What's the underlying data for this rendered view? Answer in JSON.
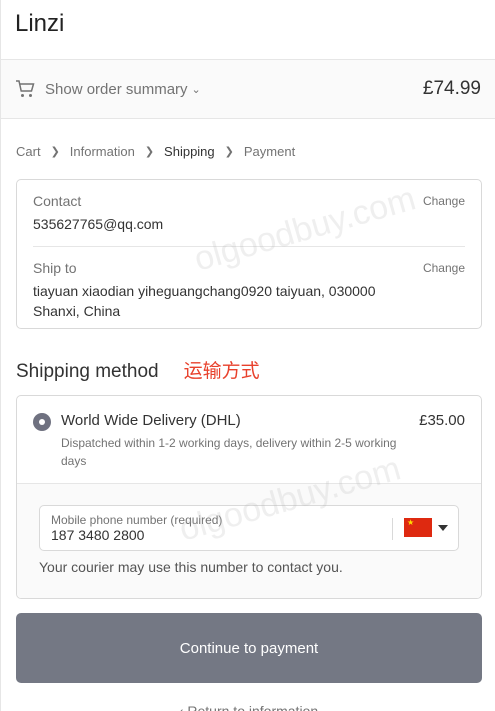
{
  "header": {
    "store_name": "Linzi"
  },
  "summary": {
    "toggle_label": "Show order summary",
    "total": "£74.99"
  },
  "breadcrumb": {
    "items": [
      "Cart",
      "Information",
      "Shipping",
      "Payment"
    ]
  },
  "review": {
    "contact_label": "Contact",
    "contact_value": "535627765@qq.com",
    "ship_label": "Ship to",
    "ship_value": "tiayuan xiaodian yiheguangchang0920 taiyuan, 030000 Shanxi, China",
    "change_label": "Change"
  },
  "shipping": {
    "title": "Shipping method",
    "note": "运输方式",
    "method_name": "World Wide Delivery (DHL)",
    "method_desc": "Dispatched within 1-2 working days, delivery within 2-5 working days",
    "method_price": "£35.00",
    "phone_label": "Mobile phone number (required)",
    "phone_value": "187 3480 2800",
    "phone_help": "Your courier may use this number to contact you."
  },
  "actions": {
    "continue_label": "Continue to payment",
    "return_label": "‹ Return to information"
  },
  "watermark": {
    "text": "olgoodbuy.com"
  },
  "colors": {
    "accent": "#747884",
    "note": "#e8412c"
  },
  "icons": {
    "cart": "cart-icon",
    "chevron": "chevron-down-icon",
    "flag": "china-flag-icon"
  }
}
